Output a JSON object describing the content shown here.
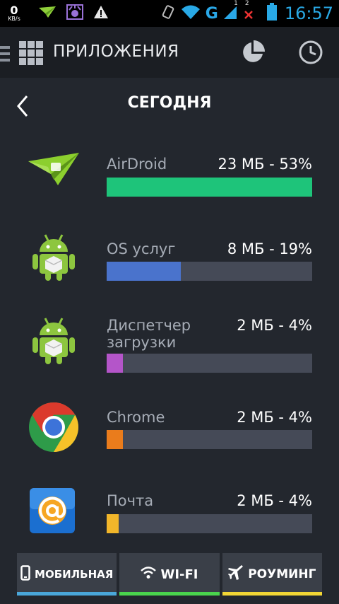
{
  "status_bar": {
    "speed_value": "0",
    "speed_unit": "KB/s",
    "network_type": "G",
    "sim1_label": "1",
    "sim2_label": "2",
    "time": "16:57"
  },
  "action_bar": {
    "title": "ПРИЛОЖЕНИЯ",
    "icons": [
      "menu-icon",
      "grid-icon",
      "pie-chart-icon",
      "clock-icon"
    ]
  },
  "header": {
    "title": "СЕГОДНЯ"
  },
  "apps": [
    {
      "name": "AirDroid",
      "usage": "23 МБ - 53%",
      "percent": 53,
      "color": "#1ec47a",
      "icon": "airdroid-icon"
    },
    {
      "name": "OS услуг",
      "usage": "8 МБ - 19%",
      "percent": 19,
      "color": "#4a73cc",
      "icon": "android-icon"
    },
    {
      "name": "Диспетчер\nзагрузки",
      "usage": "2 МБ - 4%",
      "percent": 4,
      "color": "#b455c9",
      "icon": "android-icon"
    },
    {
      "name": "Chrome",
      "usage": "2 МБ - 4%",
      "percent": 4,
      "color": "#ea7c1c",
      "icon": "chrome-icon"
    },
    {
      "name": "Почта",
      "usage": "2 МБ - 4%",
      "percent": 4,
      "color": "#f2b62a",
      "icon": "mail-icon"
    }
  ],
  "tabs": [
    {
      "label": "МОБИЛЬНАЯ",
      "color": "#4aa7d9",
      "icon": "phone-icon"
    },
    {
      "label": "WI-FI",
      "color": "#4ad44d",
      "icon": "wifi-icon"
    },
    {
      "label": "РОУМИНГ",
      "color": "#f2d635",
      "icon": "airplane-icon"
    }
  ]
}
